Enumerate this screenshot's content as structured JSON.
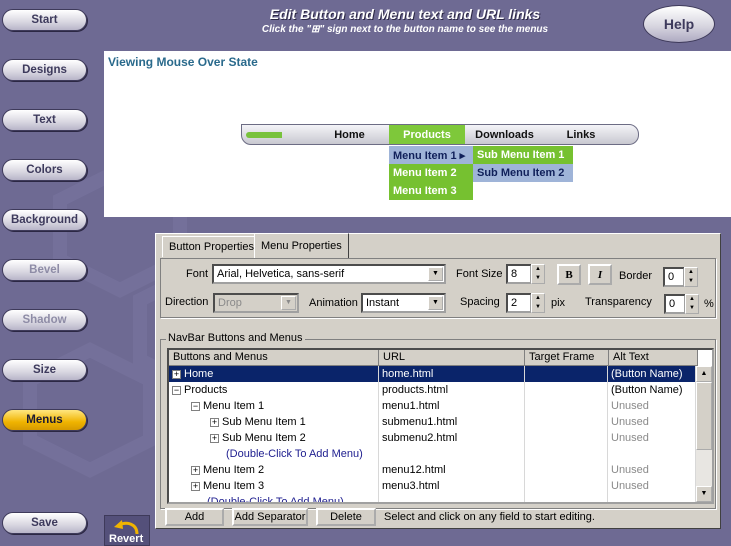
{
  "nav": [
    {
      "label": "Start",
      "state": "normal"
    },
    {
      "label": "Designs",
      "state": "normal"
    },
    {
      "label": "Text",
      "state": "normal"
    },
    {
      "label": "Colors",
      "state": "normal"
    },
    {
      "label": "Background",
      "state": "normal"
    },
    {
      "label": "Bevel",
      "state": "disabled"
    },
    {
      "label": "Shadow",
      "state": "disabled"
    },
    {
      "label": "Size",
      "state": "normal"
    },
    {
      "label": "Menus",
      "state": "active"
    },
    {
      "label": "Save",
      "state": "normal"
    }
  ],
  "header": {
    "title": "Edit Button and Menu text and URL links",
    "subtitle": "Click the \"⊞\" sign next to the button name to see the menus",
    "help_label": "Help"
  },
  "preview": {
    "title": "Viewing Mouse Over State",
    "bar_items": [
      "Home",
      "Products",
      "Downloads",
      "Links"
    ],
    "dropdown": [
      "Menu Item 1 ▸",
      "Menu Item 2",
      "Menu Item 3"
    ],
    "submenu": [
      "Sub Menu Item 1",
      "Sub Menu Item 2"
    ]
  },
  "tabs": {
    "button_props": "Button Properties",
    "menu_props": "Menu Properties"
  },
  "props": {
    "font_label": "Font",
    "font_value": "Arial, Helvetica, sans-serif",
    "fontsize_label": "Font Size",
    "fontsize_value": "8",
    "bold": "B",
    "italic": "I",
    "border_label": "Border",
    "border_value": "0",
    "direction_label": "Direction",
    "direction_value": "Drop",
    "animation_label": "Animation",
    "animation_value": "Instant",
    "spacing_label": "Spacing",
    "spacing_value": "2",
    "spacing_unit": "pix",
    "transparency_label": "Transparency",
    "transparency_value": "0",
    "transparency_unit": "%"
  },
  "grid": {
    "group_label": "NavBar Buttons and Menus",
    "headers": [
      "Buttons and Menus",
      "URL",
      "Target Frame",
      "Alt Text"
    ],
    "rows": [
      {
        "sign": "+",
        "name": "Home",
        "url": "home.html",
        "tf": "",
        "alt": "(Button Name)"
      },
      {
        "sign": "−",
        "name": "Products",
        "url": "products.html",
        "tf": "",
        "alt": "(Button Name)"
      },
      {
        "sign": "−",
        "name": "Menu Item 1",
        "url": "menu1.html",
        "tf": "",
        "alt": "Unused"
      },
      {
        "sign": "+",
        "name": "Sub Menu Item 1",
        "url": "submenu1.html",
        "tf": "",
        "alt": "Unused"
      },
      {
        "sign": "+",
        "name": "Sub Menu Item 2",
        "url": "submenu2.html",
        "tf": "",
        "alt": "Unused"
      },
      {
        "sign": "",
        "name": "(Double-Click To Add Menu)",
        "url": "",
        "tf": "",
        "alt": ""
      },
      {
        "sign": "+",
        "name": "Menu Item 2",
        "url": "menu12.html",
        "tf": "",
        "alt": "Unused"
      },
      {
        "sign": "+",
        "name": "Menu Item 3",
        "url": "menu3.html",
        "tf": "",
        "alt": "Unused"
      },
      {
        "sign": "",
        "name": "(Double-Click To Add Menu)",
        "url": "",
        "tf": "",
        "alt": ""
      }
    ]
  },
  "actions": {
    "add": "Add",
    "add_separator": "Add Separator",
    "delete": "Delete",
    "hint": "Select and click on any field to start editing."
  },
  "revert_label": "Revert"
}
